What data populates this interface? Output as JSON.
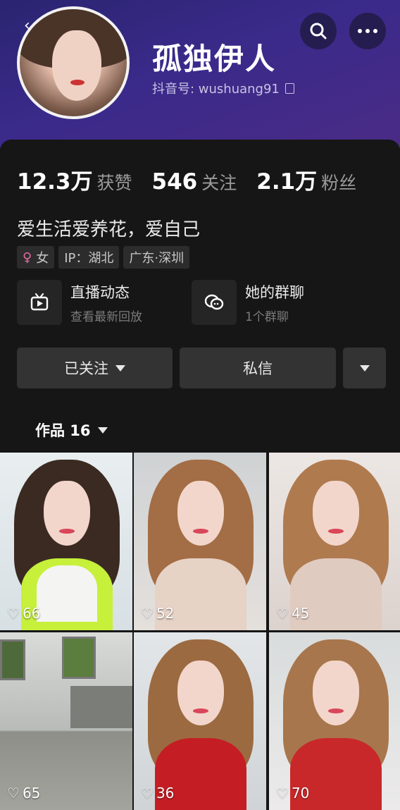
{
  "profile": {
    "name": "孤独伊人",
    "account_id": "抖音号: wushuang91"
  },
  "stats": [
    {
      "value": "12.3万",
      "label": "获赞"
    },
    {
      "value": "546",
      "label": "关注"
    },
    {
      "value": "2.1万",
      "label": "粉丝"
    }
  ],
  "bio": "爱生活爱养花，爱自己",
  "tags": {
    "gender": "女",
    "ip": "IP：湖北",
    "location": "广东·深圳"
  },
  "features": {
    "live": {
      "title": "直播动态",
      "subtitle": "查看最新回放"
    },
    "group": {
      "title": "她的群聊",
      "subtitle": "1个群聊"
    }
  },
  "actions": {
    "follow": "已关注",
    "message": "私信"
  },
  "works_tab": "作品 16",
  "grid": [
    {
      "likes": "66"
    },
    {
      "likes": "52"
    },
    {
      "likes": "45"
    },
    {
      "likes": "65"
    },
    {
      "likes": "36"
    },
    {
      "likes": "70"
    }
  ],
  "colors": {
    "header_gradient_start": "#2a2470",
    "header_gradient_end": "#4a2b86",
    "background": "#161616",
    "button": "#333333",
    "gender_icon": "#e86aa0"
  }
}
